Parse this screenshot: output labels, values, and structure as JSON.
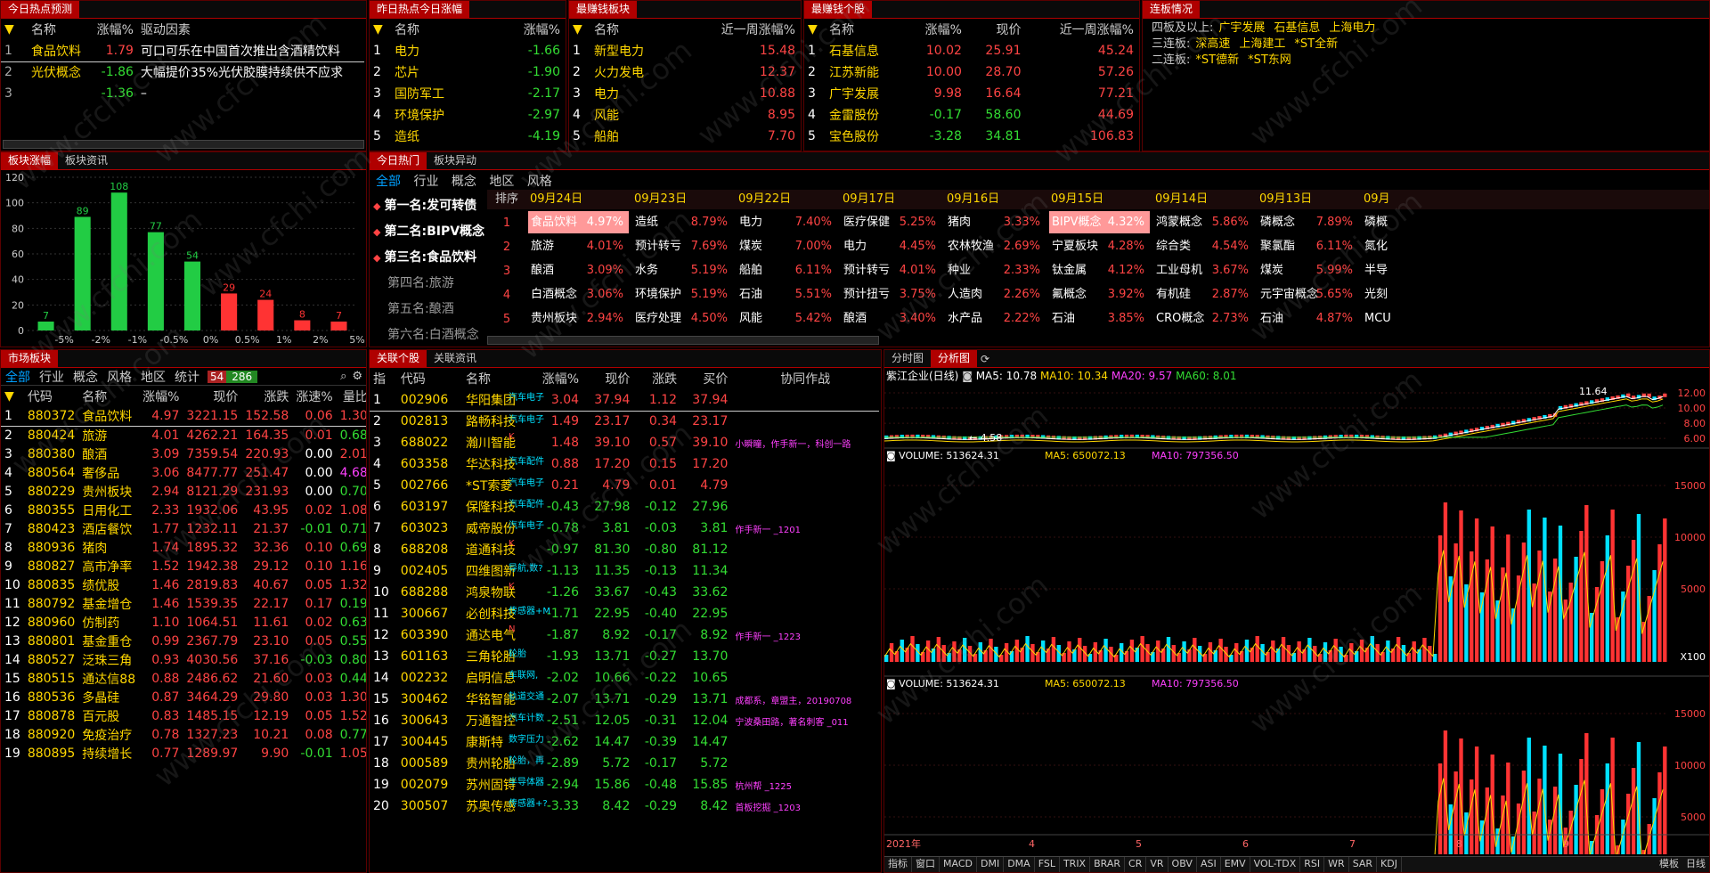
{
  "panels": {
    "p1": {
      "tab": "今日热点预测",
      "headers": [
        "名称",
        "涨幅%",
        "驱动因素"
      ],
      "rows": [
        {
          "no": "1",
          "name": "食品饮料",
          "pct": "1.79",
          "cls": "red",
          "reason": "可口可乐在中国首次推出含酒精饮料"
        },
        {
          "no": "2",
          "name": "光伏概念",
          "pct": "-1.86",
          "cls": "green",
          "reason": "大幅提价35%光伏胶膜持续供不应求"
        },
        {
          "no": "3",
          "name": "",
          "pct": "-1.36",
          "cls": "green",
          "reason": "–"
        }
      ]
    },
    "p2": {
      "tab": "昨日热点今日涨幅",
      "headers": [
        "名称",
        "涨幅%"
      ],
      "rows": [
        {
          "no": "1",
          "name": "电力",
          "pct": "-1.66"
        },
        {
          "no": "2",
          "name": "芯片",
          "pct": "-1.90"
        },
        {
          "no": "3",
          "name": "国防军工",
          "pct": "-2.17"
        },
        {
          "no": "4",
          "name": "环境保护",
          "pct": "-2.97"
        },
        {
          "no": "5",
          "name": "造纸",
          "pct": "-4.19"
        }
      ]
    },
    "p3": {
      "tab": "最赚钱板块",
      "headers": [
        "名称",
        "近一周涨幅%"
      ],
      "rows": [
        {
          "no": "1",
          "name": "新型电力",
          "pct": "15.48"
        },
        {
          "no": "2",
          "name": "火力发电",
          "pct": "12.37"
        },
        {
          "no": "3",
          "name": "电力",
          "pct": "10.88"
        },
        {
          "no": "4",
          "name": "风能",
          "pct": "8.95"
        },
        {
          "no": "5",
          "name": "船舶",
          "pct": "7.70"
        }
      ]
    },
    "p4": {
      "tab": "最赚钱个股",
      "headers": [
        "名称",
        "涨幅%",
        "现价",
        "近一周涨幅%"
      ],
      "rows": [
        {
          "no": "1",
          "name": "石基信息",
          "pct": "10.02",
          "pc": "red",
          "price": "25.91",
          "pr": "red",
          "week": "45.24"
        },
        {
          "no": "2",
          "name": "江苏新能",
          "pct": "10.00",
          "pc": "red",
          "price": "28.70",
          "pr": "red",
          "week": "57.26"
        },
        {
          "no": "3",
          "name": "广宇发展",
          "pct": "9.98",
          "pc": "red",
          "price": "16.64",
          "pr": "red",
          "week": "77.21"
        },
        {
          "no": "4",
          "name": "金雷股份",
          "pct": "-0.17",
          "pc": "green",
          "price": "58.60",
          "pr": "green",
          "week": "44.69"
        },
        {
          "no": "5",
          "name": "宝色股份",
          "pct": "-3.28",
          "pc": "green",
          "price": "34.81",
          "pr": "green",
          "week": "106.83"
        }
      ]
    },
    "p5": {
      "tab": "连板情况",
      "rows": [
        {
          "label": "四板及以上:",
          "items": [
            "广宇发展",
            "石基信息",
            "上海电力"
          ]
        },
        {
          "label": "三连板:",
          "items": [
            "深高速",
            "上海建工",
            "*ST全新"
          ]
        },
        {
          "label": "二连板:",
          "items": [
            "*ST德新",
            "*ST东网"
          ]
        }
      ]
    }
  },
  "bar_panel": {
    "tabs": [
      "板块涨幅",
      "板块资讯"
    ]
  },
  "chart_data": {
    "type": "bar",
    "categories": [
      "≥5%",
      "5%~2%",
      "2%~1%",
      "1%~0.5%",
      "0.5%~0%",
      "0%~0.5%",
      "0.5%~1%",
      "1%~2%",
      "2%~5%",
      "≥5%"
    ],
    "values": [
      7,
      89,
      108,
      77,
      54,
      29,
      24,
      8,
      7
    ],
    "colors": [
      "#22cc44",
      "#22cc44",
      "#22cc44",
      "#22cc44",
      "#22cc44",
      "#ff3333",
      "#ff3333",
      "#ff3333",
      "#ff3333"
    ],
    "yticks": [
      "120",
      "100",
      "80",
      "60",
      "40",
      "20",
      "0"
    ],
    "ylim": [
      0,
      120
    ],
    "xticks": [
      "-5%",
      "-2%",
      "-1%",
      "-0.5%",
      "0%",
      "0.5%",
      "1%",
      "2%",
      "5%"
    ]
  },
  "hot": {
    "tabs": [
      "今日热门",
      "板块异动"
    ],
    "subtabs": [
      "全部",
      "行业",
      "概念",
      "地区",
      "风格"
    ],
    "ranks": [
      "第一名:发可转债",
      "第二名:BIPV概念",
      "第三名:食品饮料",
      "第四名:旅游",
      "第五名:酿酒",
      "第六名:白酒概念"
    ],
    "rank_label": "排序",
    "rank_nums": [
      "1",
      "2",
      "3",
      "4",
      "5",
      "6"
    ],
    "dates": [
      "09月24日",
      "09月23日",
      "09月22日",
      "09月17日",
      "09月16日",
      "09月15日",
      "09月14日",
      "09月13日",
      "09月"
    ],
    "grid": [
      [
        [
          "食品饮料",
          "4.97%"
        ],
        [
          "造纸",
          "8.79%"
        ],
        [
          "电力",
          "7.40%"
        ],
        [
          "医疗保健",
          "5.25%"
        ],
        [
          "猪肉",
          "3.33%"
        ],
        [
          "BIPV概念",
          "4.32%"
        ],
        [
          "鸿蒙概念",
          "5.86%"
        ],
        [
          "磷概念",
          "7.89%"
        ],
        [
          "磷概",
          ""
        ]
      ],
      [
        [
          "旅游",
          "4.01%"
        ],
        [
          "预计转亏",
          "7.69%"
        ],
        [
          "煤炭",
          "7.00%"
        ],
        [
          "电力",
          "4.45%"
        ],
        [
          "农林牧渔",
          "2.69%"
        ],
        [
          "宁夏板块",
          "4.28%"
        ],
        [
          "综合类",
          "4.54%"
        ],
        [
          "聚氯酯",
          "6.11%"
        ],
        [
          "氮化",
          ""
        ]
      ],
      [
        [
          "酿酒",
          "3.09%"
        ],
        [
          "水务",
          "5.19%"
        ],
        [
          "船舶",
          "6.11%"
        ],
        [
          "预计转亏",
          "4.01%"
        ],
        [
          "种业",
          "2.33%"
        ],
        [
          "钛金属",
          "4.12%"
        ],
        [
          "工业母机",
          "3.67%"
        ],
        [
          "煤炭",
          "5.99%"
        ],
        [
          "半导",
          ""
        ]
      ],
      [
        [
          "白酒概念",
          "3.06%"
        ],
        [
          "环境保护",
          "5.19%"
        ],
        [
          "石油",
          "5.51%"
        ],
        [
          "预计扭亏",
          "3.75%"
        ],
        [
          "人造肉",
          "2.26%"
        ],
        [
          "氟概念",
          "3.92%"
        ],
        [
          "有机硅",
          "2.87%"
        ],
        [
          "元宇宙概念",
          "5.65%"
        ],
        [
          "光刻",
          ""
        ]
      ],
      [
        [
          "贵州板块",
          "2.94%"
        ],
        [
          "医疗处理",
          "4.50%"
        ],
        [
          "风能",
          "5.42%"
        ],
        [
          "酿酒",
          "3.40%"
        ],
        [
          "水产品",
          "2.22%"
        ],
        [
          "石油",
          "3.85%"
        ],
        [
          "CRO概念",
          "2.73%"
        ],
        [
          "石油",
          "4.87%"
        ],
        [
          "MCU",
          ""
        ]
      ]
    ]
  },
  "market": {
    "tab": "市场板块",
    "subtabs": [
      "全部",
      "行业",
      "概念",
      "风格",
      "地区",
      "统计"
    ],
    "badge_up": "54",
    "badge_dn": "286",
    "headers": [
      "代码",
      "名称",
      "涨幅%",
      "现价",
      "涨跌",
      "涨速%",
      "量比"
    ],
    "rows": [
      [
        "1",
        "880372",
        "食品饮料",
        "4.97",
        "3221.15",
        "152.58",
        "0.06",
        "1.30"
      ],
      [
        "2",
        "880424",
        "旅游",
        "4.01",
        "4262.21",
        "164.35",
        "0.01",
        "0.68"
      ],
      [
        "3",
        "880380",
        "酿酒",
        "3.09",
        "7359.54",
        "220.93",
        "0.00",
        "2.01"
      ],
      [
        "4",
        "880564",
        "奢侈品",
        "3.06",
        "8477.77",
        "251.47",
        "0.00",
        "4.68"
      ],
      [
        "5",
        "880229",
        "贵州板块",
        "2.94",
        "8121.29",
        "231.93",
        "0.00",
        "0.70"
      ],
      [
        "6",
        "880355",
        "日用化工",
        "2.33",
        "1932.06",
        "43.95",
        "0.02",
        "1.08"
      ],
      [
        "7",
        "880423",
        "酒店餐饮",
        "1.77",
        "1232.11",
        "21.37",
        "-0.01",
        "0.71"
      ],
      [
        "8",
        "880936",
        "猪肉",
        "1.74",
        "1895.32",
        "32.36",
        "0.10",
        "0.69"
      ],
      [
        "9",
        "880827",
        "高市净率",
        "1.52",
        "1942.38",
        "29.12",
        "0.10",
        "1.16"
      ],
      [
        "10",
        "880835",
        "绩优股",
        "1.46",
        "2819.83",
        "40.67",
        "0.05",
        "1.32"
      ],
      [
        "11",
        "880792",
        "基金增仓",
        "1.46",
        "1539.35",
        "22.17",
        "0.17",
        "0.19"
      ],
      [
        "12",
        "880960",
        "仿制药",
        "1.10",
        "1064.51",
        "11.61",
        "0.02",
        "0.63"
      ],
      [
        "13",
        "880801",
        "基金重仓",
        "0.99",
        "2367.79",
        "23.10",
        "0.05",
        "0.55"
      ],
      [
        "14",
        "880527",
        "泛珠三角",
        "0.93",
        "4030.56",
        "37.16",
        "-0.03",
        "0.80"
      ],
      [
        "15",
        "880515",
        "通达信88",
        "0.88",
        "2486.62",
        "21.60",
        "0.03",
        "0.44"
      ],
      [
        "16",
        "880536",
        "多晶硅",
        "0.87",
        "3464.29",
        "29.80",
        "0.03",
        "1.30"
      ],
      [
        "17",
        "880878",
        "百元股",
        "0.83",
        "1485.15",
        "12.19",
        "0.05",
        "1.52"
      ],
      [
        "18",
        "880920",
        "免疫治疗",
        "0.78",
        "1327.23",
        "10.21",
        "0.08",
        "0.77"
      ],
      [
        "19",
        "880895",
        "持续增长",
        "0.77",
        "1289.97",
        "9.90",
        "-0.01",
        "1.05"
      ]
    ]
  },
  "related": {
    "tabs": [
      "关联个股",
      "关联资讯"
    ],
    "headers": [
      "指",
      "代码",
      "名称",
      "涨幅%",
      "现价",
      "涨跌",
      "买价",
      "协同作战"
    ],
    "rows": [
      [
        "1",
        "002906",
        "华阳集团",
        "汽车电子",
        "3.04",
        "37.94",
        "1.12",
        "37.94",
        ""
      ],
      [
        "2",
        "002813",
        "路畅科技",
        "汽车电子",
        "1.49",
        "23.17",
        "0.34",
        "23.17",
        ""
      ],
      [
        "3",
        "688022",
        "瀚川智能",
        "K",
        "1.48",
        "39.10",
        "0.57",
        "39.10",
        "小瞬瞳，作手新一，科创一路"
      ],
      [
        "4",
        "603358",
        "华达科技",
        "汽车配件",
        "0.88",
        "17.20",
        "0.15",
        "17.20",
        ""
      ],
      [
        "5",
        "002766",
        "*ST索菱",
        "汽车电子",
        "0.21",
        "4.79",
        "0.01",
        "4.79",
        ""
      ],
      [
        "6",
        "603197",
        "保隆科技",
        "汽车配件",
        "-0.43",
        "27.98",
        "-0.12",
        "27.96",
        ""
      ],
      [
        "7",
        "603023",
        "威帝股份",
        "汽车电子",
        "-0.78",
        "3.81",
        "-0.03",
        "3.81",
        "作手新一 _1201"
      ],
      [
        "8",
        "688208",
        "道通科技",
        "K",
        "-0.97",
        "81.30",
        "-0.80",
        "81.12",
        ""
      ],
      [
        "9",
        "002405",
        "四维图新",
        "导航,数?",
        "-1.13",
        "11.35",
        "-0.13",
        "11.34",
        ""
      ],
      [
        "10",
        "688288",
        "鸿泉物联",
        "K",
        "-1.26",
        "33.67",
        "-0.43",
        "33.62",
        ""
      ],
      [
        "11",
        "300667",
        "必创科技",
        "传感器+M",
        "-1.71",
        "22.95",
        "-0.40",
        "22.95",
        ""
      ],
      [
        "12",
        "603390",
        "通达电气",
        "N",
        "-1.87",
        "8.92",
        "-0.17",
        "8.92",
        "作手新一 _1223"
      ],
      [
        "13",
        "601163",
        "三角轮胎",
        "轮胎",
        "-1.93",
        "13.71",
        "-0.27",
        "13.70",
        ""
      ],
      [
        "14",
        "002232",
        "启明信息",
        "车联网,",
        "-2.02",
        "10.66",
        "-0.22",
        "10.65",
        ""
      ],
      [
        "15",
        "300462",
        "华铭智能",
        "轨道交通",
        "-2.07",
        "13.71",
        "-0.29",
        "13.71",
        "成都系，章盟主，20190708"
      ],
      [
        "16",
        "300643",
        "万通智控",
        "汽车计数",
        "-2.51",
        "12.05",
        "-0.31",
        "12.04",
        "宁波桑田路，著名刺客 _011"
      ],
      [
        "17",
        "300445",
        "康斯特",
        "数字压力",
        "-2.62",
        "14.47",
        "-0.39",
        "14.47",
        ""
      ],
      [
        "18",
        "000589",
        "贵州轮胎",
        "轮胎，再",
        "-2.89",
        "5.72",
        "-0.17",
        "5.72",
        ""
      ],
      [
        "19",
        "002079",
        "苏州固锝",
        "半导体器",
        "-2.94",
        "15.86",
        "-0.48",
        "15.85",
        "杭州帮 _1225"
      ],
      [
        "20",
        "300507",
        "苏奥传感",
        "传感器+?",
        "-3.33",
        "8.42",
        "-0.29",
        "8.42",
        "首板挖掘 _1203"
      ]
    ]
  },
  "kline": {
    "tabs": [
      "分时图",
      "分析图"
    ],
    "title": "紫江企业(日线)",
    "ma5": "MA5: 10.78",
    "ma10": "MA10: 10.34",
    "ma20": "MA20: 9.57",
    "ma60": "MA60: 8.01",
    "yticks": [
      "12.00",
      "10.00",
      "8.00",
      "6.00"
    ],
    "hi": "11.64",
    "lo": "4.58",
    "vol1": {
      "vol": "VOLUME: 513624.31",
      "ma5": "MA5: 650072.13",
      "ma10": "MA10: 797356.50"
    },
    "vol2": {
      "vol": "VOLUME: 513624.31",
      "ma5": "MA5: 650072.13",
      "ma10": "MA10: 797356.50"
    },
    "volticks": [
      "15000",
      "10000",
      "5000"
    ],
    "unit": "X100",
    "xlabels": [
      "2021年",
      "4",
      "5",
      "6",
      "7",
      "8",
      "9"
    ],
    "bottom_tabs": [
      "指标",
      "窗口",
      "MACD",
      "DMI",
      "DMA",
      "FSL",
      "TRIX",
      "BRAR",
      "CR",
      "VR",
      "OBV",
      "ASI",
      "EMV",
      "VOL-TDX",
      "RSI",
      "WR",
      "SAR",
      "KDJ"
    ],
    "right_tabs": [
      "模板",
      "日线"
    ]
  },
  "watermark": "www.cfchi.com"
}
